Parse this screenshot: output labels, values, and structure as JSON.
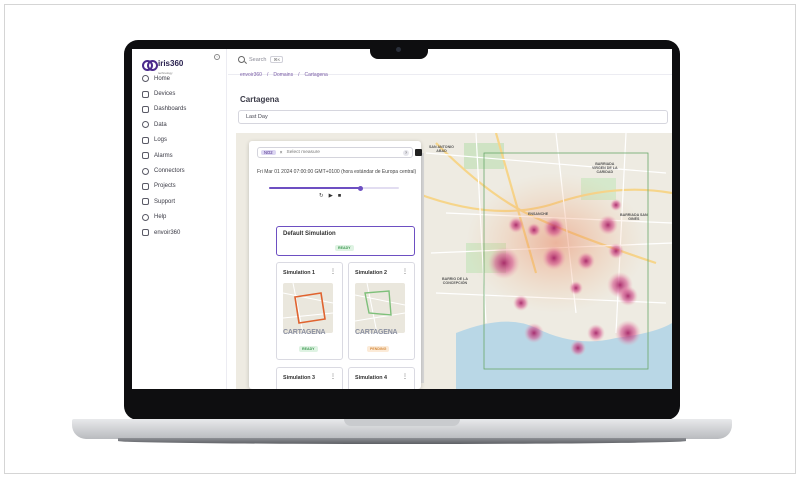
{
  "app": {
    "brand": "iris360",
    "brand_sub": "technology",
    "collapse_glyph": "‹"
  },
  "sidebar": {
    "items": [
      {
        "label": "Home",
        "icon": "home-icon"
      },
      {
        "label": "Devices",
        "icon": "wifi-icon"
      },
      {
        "label": "Dashboards",
        "icon": "dashboard-icon"
      },
      {
        "label": "Data",
        "icon": "data-icon"
      },
      {
        "label": "Logs",
        "icon": "logs-icon"
      },
      {
        "label": "Alarms",
        "icon": "alarm-icon"
      },
      {
        "label": "Connectors",
        "icon": "connector-icon"
      },
      {
        "label": "Projects",
        "icon": "folder-icon"
      },
      {
        "label": "Support",
        "icon": "support-icon"
      },
      {
        "label": "Help",
        "icon": "help-icon"
      },
      {
        "label": "envoir360",
        "icon": "globe-icon"
      }
    ]
  },
  "topbar": {
    "search_placeholder": "Search",
    "search_shortcut": "⌘K"
  },
  "breadcrumb": {
    "items": [
      "envoir360",
      "Domains",
      "Cartagena"
    ],
    "separator": "/"
  },
  "page": {
    "title": "Cartagena",
    "period": "Last Day"
  },
  "simulation_panel": {
    "measure_chip": "NO2",
    "measure_chip_remove": "×",
    "measure_placeholder": "Select measure",
    "help_glyph": "?",
    "timestamp": "Fri Mar 01 2024 07:00:00 GMT+0100 (hora estándar de Europa central)",
    "progress": 0.7,
    "controls": [
      "↻",
      "▶",
      "■"
    ],
    "default_simulation": {
      "title": "Default Simulation",
      "status": "READY"
    },
    "simulations": [
      {
        "title": "Simulation 1",
        "status": "READY",
        "brand": "CARTAGENA"
      },
      {
        "title": "Simulation 2",
        "status": "PENDING",
        "brand": "CARTAGENA"
      },
      {
        "title": "Simulation 3",
        "status": ""
      },
      {
        "title": "Simulation 4",
        "status": ""
      }
    ],
    "kebab_glyph": "⋮"
  },
  "map": {
    "labels": {
      "san_antonio": "SAN ANTONIO\nABAD",
      "barriada": "BARRIADA\nVIRGEN DE LA\nCARIDAD",
      "ensanche": "ENSANCHE",
      "barriada_san_gines": "BARRIADA SAN\nGINÉS",
      "barrio_concepcion": "BARRIO DE LA\nCONCEPCIÓN"
    },
    "heat_color": "#b0246a",
    "grid_color": "#6aa86a"
  }
}
